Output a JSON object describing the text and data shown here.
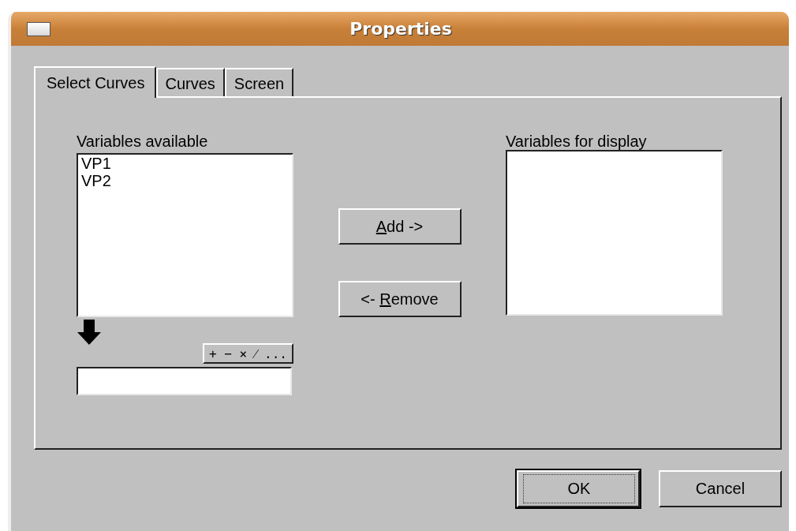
{
  "window": {
    "title": "Properties"
  },
  "tabs": [
    {
      "label": "Select Curves",
      "selected": true
    },
    {
      "label": "Curves",
      "selected": false
    },
    {
      "label": "Screen",
      "selected": false
    }
  ],
  "available": {
    "label": "Variables available",
    "items": [
      "VP1",
      "VP2"
    ]
  },
  "operators": {
    "label": "+ − × ⁄ ..."
  },
  "add_button": {
    "key": "A",
    "post": "dd ->"
  },
  "remove_button": {
    "pre": "<- ",
    "key": "R",
    "post": "emove"
  },
  "display": {
    "label": "Variables for display"
  },
  "buttons": [
    {
      "label": "OK",
      "default": true
    },
    {
      "label": "Cancel",
      "default": false
    }
  ]
}
